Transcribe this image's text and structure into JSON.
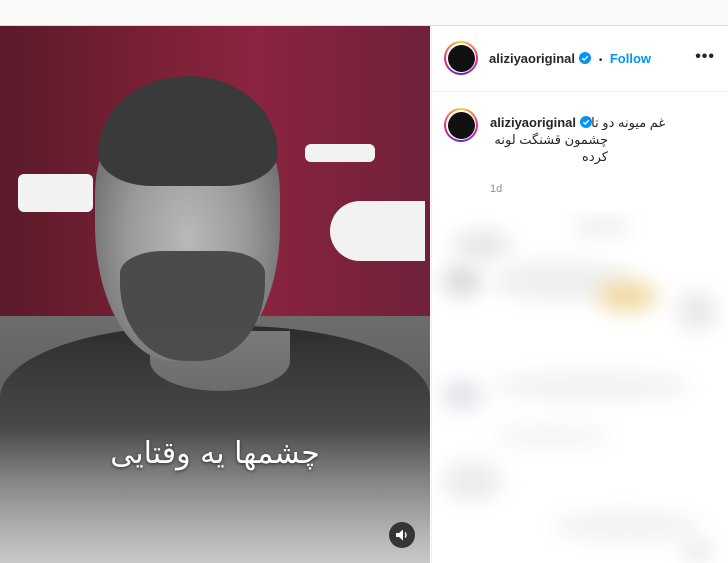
{
  "post": {
    "username": "aliziyaoriginal",
    "follow_label": "Follow",
    "separator": "•",
    "caption_line1": "غم میونه دو تا",
    "caption_line2": "چشمون قشنگت لونه کرده",
    "time": "1d",
    "video_overlay_text": "چشمها یه وقتایی"
  },
  "icons": {
    "verified": "verified-badge-icon",
    "more": "more-options-icon",
    "sound": "speaker-icon"
  },
  "colors": {
    "accent": "#0095f6",
    "verified": "#0095f6",
    "text": "#262626",
    "muted": "#8e8e8e"
  }
}
